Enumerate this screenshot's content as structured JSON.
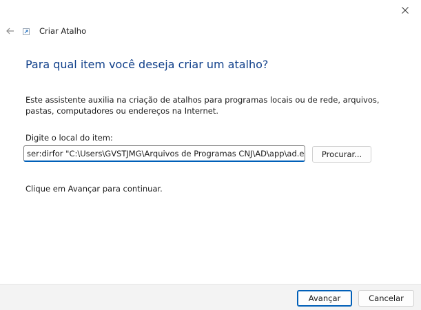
{
  "window": {
    "title": "Criar Atalho",
    "close_icon": "close-icon",
    "back_icon": "arrow-left-icon",
    "app_icon": "shortcut-icon"
  },
  "main": {
    "heading": "Para qual item você deseja criar um atalho?",
    "description": "Este assistente auxilia na criação de atalhos para programas locais ou de rede, arquivos, pastas, computadores ou endereços na Internet.",
    "location_label": "Digite o local do item:",
    "location_value": "ser:dirfor \"C:\\Users\\GVSTJMG\\Arquivos de Programas CNJ\\AD\\app\\ad.exe\"",
    "browse_label": "Procurar...",
    "hint": "Clique em Avançar para continuar."
  },
  "footer": {
    "next_label": "Avançar",
    "cancel_label": "Cancelar"
  },
  "colors": {
    "heading": "#0f3f8a",
    "accent": "#005fb8",
    "footer_bg": "#f3f3f3"
  }
}
